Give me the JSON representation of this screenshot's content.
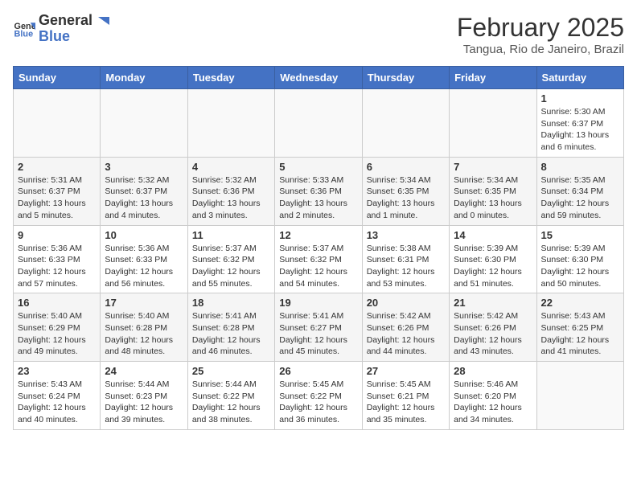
{
  "header": {
    "logo_general": "General",
    "logo_blue": "Blue",
    "month": "February 2025",
    "location": "Tangua, Rio de Janeiro, Brazil"
  },
  "weekdays": [
    "Sunday",
    "Monday",
    "Tuesday",
    "Wednesday",
    "Thursday",
    "Friday",
    "Saturday"
  ],
  "weeks": [
    [
      {
        "day": "",
        "info": ""
      },
      {
        "day": "",
        "info": ""
      },
      {
        "day": "",
        "info": ""
      },
      {
        "day": "",
        "info": ""
      },
      {
        "day": "",
        "info": ""
      },
      {
        "day": "",
        "info": ""
      },
      {
        "day": "1",
        "info": "Sunrise: 5:30 AM\nSunset: 6:37 PM\nDaylight: 13 hours and 6 minutes."
      }
    ],
    [
      {
        "day": "2",
        "info": "Sunrise: 5:31 AM\nSunset: 6:37 PM\nDaylight: 13 hours and 5 minutes."
      },
      {
        "day": "3",
        "info": "Sunrise: 5:32 AM\nSunset: 6:37 PM\nDaylight: 13 hours and 4 minutes."
      },
      {
        "day": "4",
        "info": "Sunrise: 5:32 AM\nSunset: 6:36 PM\nDaylight: 13 hours and 3 minutes."
      },
      {
        "day": "5",
        "info": "Sunrise: 5:33 AM\nSunset: 6:36 PM\nDaylight: 13 hours and 2 minutes."
      },
      {
        "day": "6",
        "info": "Sunrise: 5:34 AM\nSunset: 6:35 PM\nDaylight: 13 hours and 1 minute."
      },
      {
        "day": "7",
        "info": "Sunrise: 5:34 AM\nSunset: 6:35 PM\nDaylight: 13 hours and 0 minutes."
      },
      {
        "day": "8",
        "info": "Sunrise: 5:35 AM\nSunset: 6:34 PM\nDaylight: 12 hours and 59 minutes."
      }
    ],
    [
      {
        "day": "9",
        "info": "Sunrise: 5:36 AM\nSunset: 6:33 PM\nDaylight: 12 hours and 57 minutes."
      },
      {
        "day": "10",
        "info": "Sunrise: 5:36 AM\nSunset: 6:33 PM\nDaylight: 12 hours and 56 minutes."
      },
      {
        "day": "11",
        "info": "Sunrise: 5:37 AM\nSunset: 6:32 PM\nDaylight: 12 hours and 55 minutes."
      },
      {
        "day": "12",
        "info": "Sunrise: 5:37 AM\nSunset: 6:32 PM\nDaylight: 12 hours and 54 minutes."
      },
      {
        "day": "13",
        "info": "Sunrise: 5:38 AM\nSunset: 6:31 PM\nDaylight: 12 hours and 53 minutes."
      },
      {
        "day": "14",
        "info": "Sunrise: 5:39 AM\nSunset: 6:30 PM\nDaylight: 12 hours and 51 minutes."
      },
      {
        "day": "15",
        "info": "Sunrise: 5:39 AM\nSunset: 6:30 PM\nDaylight: 12 hours and 50 minutes."
      }
    ],
    [
      {
        "day": "16",
        "info": "Sunrise: 5:40 AM\nSunset: 6:29 PM\nDaylight: 12 hours and 49 minutes."
      },
      {
        "day": "17",
        "info": "Sunrise: 5:40 AM\nSunset: 6:28 PM\nDaylight: 12 hours and 48 minutes."
      },
      {
        "day": "18",
        "info": "Sunrise: 5:41 AM\nSunset: 6:28 PM\nDaylight: 12 hours and 46 minutes."
      },
      {
        "day": "19",
        "info": "Sunrise: 5:41 AM\nSunset: 6:27 PM\nDaylight: 12 hours and 45 minutes."
      },
      {
        "day": "20",
        "info": "Sunrise: 5:42 AM\nSunset: 6:26 PM\nDaylight: 12 hours and 44 minutes."
      },
      {
        "day": "21",
        "info": "Sunrise: 5:42 AM\nSunset: 6:26 PM\nDaylight: 12 hours and 43 minutes."
      },
      {
        "day": "22",
        "info": "Sunrise: 5:43 AM\nSunset: 6:25 PM\nDaylight: 12 hours and 41 minutes."
      }
    ],
    [
      {
        "day": "23",
        "info": "Sunrise: 5:43 AM\nSunset: 6:24 PM\nDaylight: 12 hours and 40 minutes."
      },
      {
        "day": "24",
        "info": "Sunrise: 5:44 AM\nSunset: 6:23 PM\nDaylight: 12 hours and 39 minutes."
      },
      {
        "day": "25",
        "info": "Sunrise: 5:44 AM\nSunset: 6:22 PM\nDaylight: 12 hours and 38 minutes."
      },
      {
        "day": "26",
        "info": "Sunrise: 5:45 AM\nSunset: 6:22 PM\nDaylight: 12 hours and 36 minutes."
      },
      {
        "day": "27",
        "info": "Sunrise: 5:45 AM\nSunset: 6:21 PM\nDaylight: 12 hours and 35 minutes."
      },
      {
        "day": "28",
        "info": "Sunrise: 5:46 AM\nSunset: 6:20 PM\nDaylight: 12 hours and 34 minutes."
      },
      {
        "day": "",
        "info": ""
      }
    ]
  ]
}
